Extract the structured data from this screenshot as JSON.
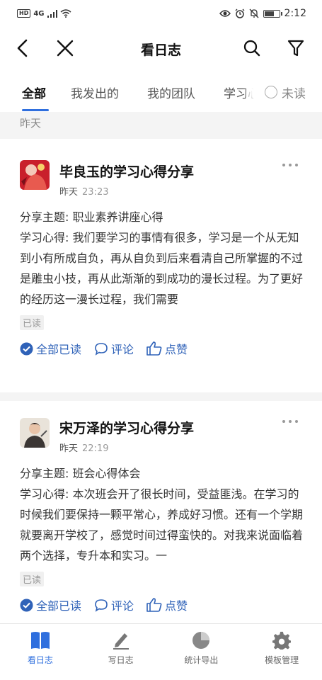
{
  "status_bar": {
    "hd": "HD",
    "network": "4G",
    "time": "2:12"
  },
  "header": {
    "title": "看日志"
  },
  "tabs": [
    {
      "label": "全部",
      "active": true
    },
    {
      "label": "我发出的",
      "active": false
    },
    {
      "label": "我的团队",
      "active": false
    },
    {
      "label": "学习心",
      "active": false
    }
  ],
  "unread_filter": {
    "label": "未读"
  },
  "date_separator": "昨天",
  "posts": [
    {
      "title": "毕良玉的学习心得分享",
      "day": "昨天",
      "time": "23:23",
      "topic_label": "分享主题:",
      "topic": "职业素养讲座心得",
      "content_label": "学习心得:",
      "content": "我们要学习的事情有很多，学习是一个从无知到小有所成自负，再从自负到后来看清自己所掌握的不过是雕虫小技，再从此渐渐的到成功的漫长过程。为了更好的经历这一漫长过程，我们需要",
      "read_status": "已读",
      "action_all_read": "全部已读",
      "action_comment": "评论",
      "action_like": "点赞"
    },
    {
      "title": "宋万泽的学习心得分享",
      "day": "昨天",
      "time": "22:19",
      "topic_label": "分享主题:",
      "topic": "班会心得体会",
      "content_label": "学习心得:",
      "content": "本次班会开了很长时间，受益匪浅。在学习的时候我们要保持一颗平常心，养成好习惯。还有一个学期就要离开学校了，感觉时间过得蛮快的。对我来说面临着两个选择，专升本和实习。一",
      "read_status": "已读",
      "action_all_read": "全部已读",
      "action_comment": "评论",
      "action_like": "点赞"
    }
  ],
  "bottom_nav": [
    {
      "label": "看日志",
      "icon": "book-icon",
      "active": true
    },
    {
      "label": "写日志",
      "icon": "pencil-icon",
      "active": false
    },
    {
      "label": "统计导出",
      "icon": "pie-chart-icon",
      "active": false
    },
    {
      "label": "模板管理",
      "icon": "gear-icon",
      "active": false
    }
  ],
  "colors": {
    "accent": "#2f6fde",
    "action": "#2f62b8",
    "separator": "#f4f4f4"
  }
}
